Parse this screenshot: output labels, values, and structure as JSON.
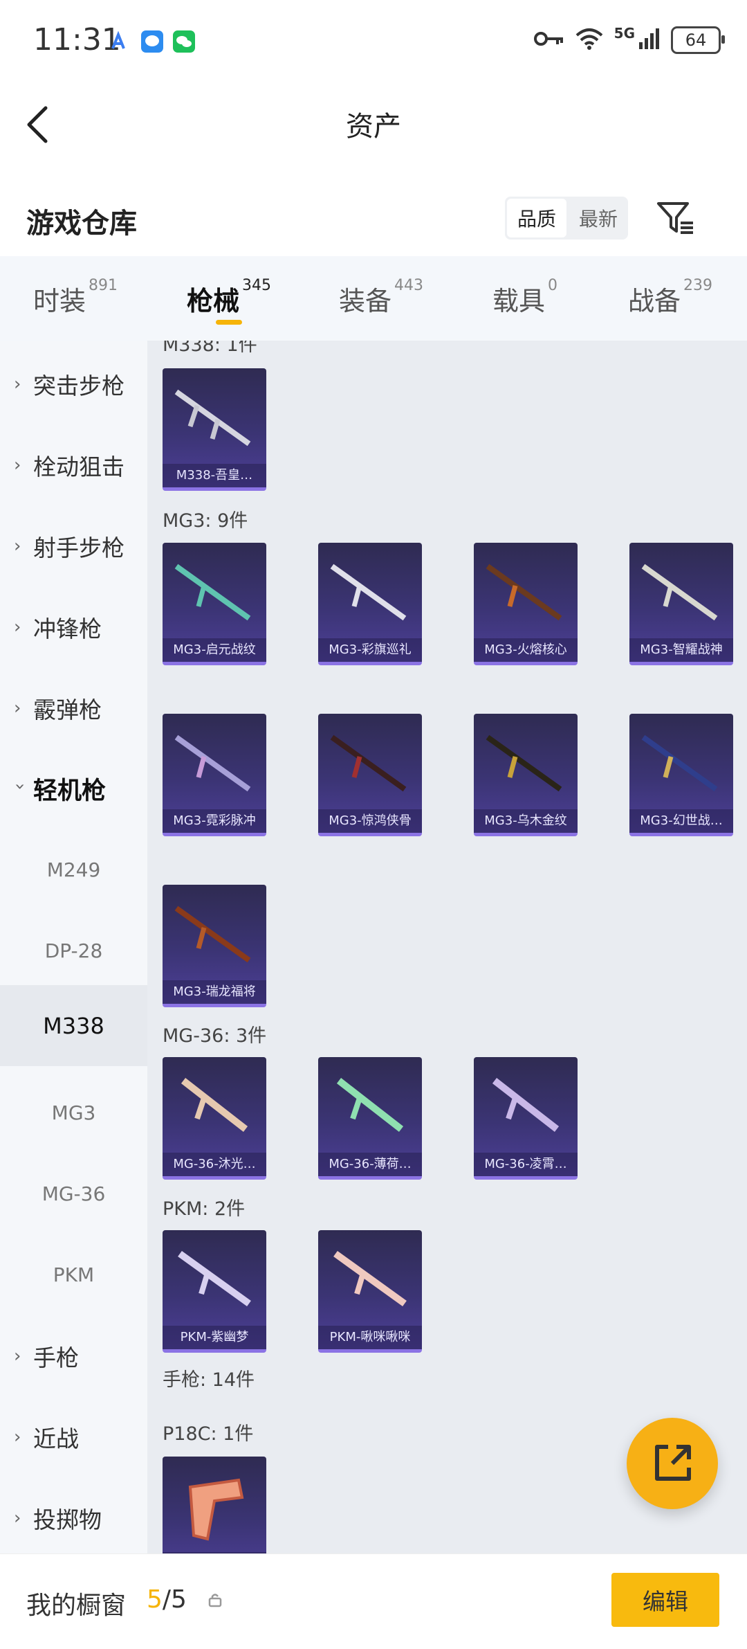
{
  "status_bar": {
    "time": "11:31",
    "network": "5G",
    "battery": "64",
    "app_icons": [
      "assistant-app-icon",
      "message-app-icon",
      "wechat-app-icon"
    ]
  },
  "nav": {
    "title": "资产"
  },
  "warehouse": {
    "title": "游戏仓库",
    "sort_options": [
      "品质",
      "最新"
    ],
    "sort_selected": "品质"
  },
  "tabs": [
    {
      "label": "时装",
      "count": "891"
    },
    {
      "label": "枪械",
      "count": "345",
      "active": true
    },
    {
      "label": "装备",
      "count": "443"
    },
    {
      "label": "载具",
      "count": "0"
    },
    {
      "label": "战备",
      "count": "239"
    }
  ],
  "sidebar": {
    "categories": [
      "突击步枪",
      "栓动狙击",
      "射手步枪",
      "冲锋枪",
      "霰弹枪",
      "轻机枪",
      "手枪",
      "近战",
      "投掷物"
    ],
    "expanded": "轻机枪",
    "subitems": [
      "M249",
      "DP-28",
      "M338",
      "MG3",
      "MG-36",
      "PKM"
    ],
    "selected_sub": "M338"
  },
  "groups": [
    {
      "header": "M338: 1件",
      "items": [
        "M338-吾皇…"
      ]
    },
    {
      "header": "MG3: 9件",
      "items": [
        "MG3-启元战纹",
        "MG3-彩旗巡礼",
        "MG3-火熔核心",
        "MG3-智耀战神",
        "MG3-霓彩脉冲",
        "MG3-惊鸿侠骨",
        "MG3-乌木金纹",
        "MG3-幻世战…",
        "MG3-瑞龙福将"
      ]
    },
    {
      "header": "MG-36: 3件",
      "items": [
        "MG-36-沐光…",
        "MG-36-薄荷…",
        "MG-36-凌霄…"
      ]
    },
    {
      "header": "PKM: 2件",
      "items": [
        "PKM-紫幽梦",
        "PKM-啾咪啾咪"
      ]
    },
    {
      "header": "手枪: 14件",
      "items": []
    },
    {
      "header": "P18C: 1件",
      "items": [
        ""
      ]
    }
  ],
  "bottom": {
    "label": "我的橱窗",
    "current": "5",
    "total": "/5",
    "edit": "编辑"
  }
}
